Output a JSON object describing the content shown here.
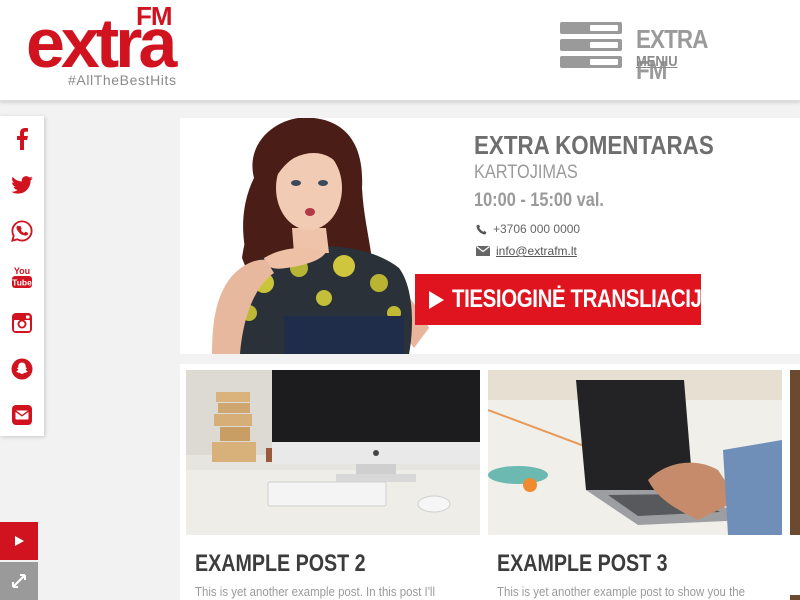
{
  "brand": {
    "logo_text": "extra",
    "logo_fm": "FM",
    "tagline": "#AllTheBestHits",
    "color": "#d0131f"
  },
  "header": {
    "menu_title": "EXTRA FM",
    "menu_label": "MENIU",
    "menu_icon": "hamburger-icon"
  },
  "social": [
    {
      "name": "facebook",
      "icon": "facebook-icon"
    },
    {
      "name": "twitter",
      "icon": "twitter-icon"
    },
    {
      "name": "whatsapp",
      "icon": "whatsapp-icon"
    },
    {
      "name": "youtube",
      "icon": "youtube-icon"
    },
    {
      "name": "instagram",
      "icon": "instagram-icon"
    },
    {
      "name": "snapchat",
      "icon": "snapchat-icon"
    },
    {
      "name": "email",
      "icon": "envelope-icon"
    }
  ],
  "show": {
    "title": "EXTRA KOMENTARAS",
    "subtitle": "KARTOJIMAS",
    "time": "10:00 - 15:00 val.",
    "phone": "+3706 000 0000",
    "email": "info@extrafm.lt",
    "live_button": "TIESIOGINĖ TRANSLIACIJA"
  },
  "posts": [
    {
      "title": "EXAMPLE POST 2",
      "excerpt": "This is yet another example post. In this post I'll"
    },
    {
      "title": "EXAMPLE POST 3",
      "excerpt": "This is yet another example post to show you the"
    }
  ],
  "controls": {
    "play_icon": "play-icon",
    "expand_icon": "expand-icon"
  },
  "colors": {
    "accent": "#d0131f",
    "live_button": "#e0141f",
    "gray": "#9a9a9a"
  }
}
